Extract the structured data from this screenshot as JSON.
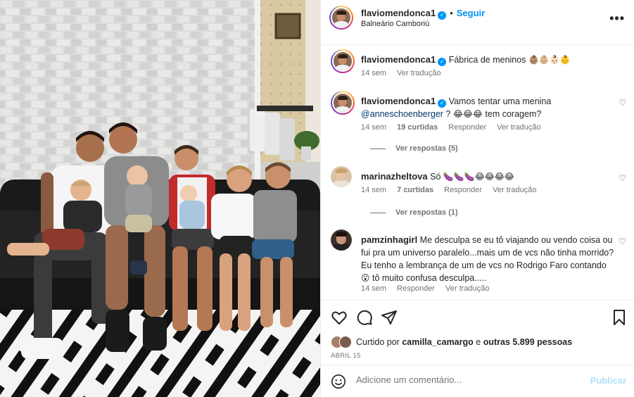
{
  "post": {
    "username": "flaviomendonca1",
    "follow_label": "Seguir",
    "location": "Balneário Camboriú",
    "more_label": "•••"
  },
  "comments": [
    {
      "username": "flaviomendonca1",
      "verified": true,
      "text": "Fábrica de meninos",
      "emojis": "👶🏽👶🏼👶🏻👶",
      "time": "14 sem",
      "translate": "Ver tradução"
    },
    {
      "username": "flaviomendonca1",
      "verified": true,
      "text_pre": "Vamos tentar uma menina",
      "mention": "@anneschoenberger",
      "text_post": "?",
      "emojis": "😂😂😂",
      "text_end": "tem coragem?",
      "time": "14 sem",
      "likes": "19 curtidas",
      "reply": "Responder",
      "translate": "Ver tradução",
      "view_replies": "Ver respostas (5)"
    },
    {
      "username": "marinazheltova",
      "text": "Só",
      "emojis": "🍆🍆🍆😂😂😂😂",
      "time": "14 sem",
      "likes": "7 curtidas",
      "reply": "Responder",
      "translate": "Ver tradução",
      "view_replies": "Ver respostas (1)"
    },
    {
      "username": "pamzinhagirl",
      "text": "Me desculpa se eu tô viajando ou vendo coisa ou fui pra um universo paralelo...mais um de vcs não tinha morrido? Eu tenho a lembrança de um de vcs no Rodrigo Faro contando",
      "emojis": "😮",
      "text_end": "tô muito confusa desculpa.....",
      "time": "14 sem",
      "reply": "Responder",
      "translate": "Ver tradução"
    }
  ],
  "likes": {
    "prefix": "Curtido por",
    "user": "camilla_camargo",
    "middle": "e",
    "others": "outras 5.899 pessoas"
  },
  "date": "ABRIL 15",
  "add_comment": {
    "placeholder": "Adicione um comentário...",
    "publish": "Publicar"
  },
  "icons": {
    "like": "heart-icon",
    "comment": "comment-icon",
    "share": "share-icon",
    "save": "bookmark-icon",
    "emoji": "emoji-icon"
  },
  "colors": {
    "accent": "#0095f6",
    "text": "#262626",
    "muted": "#737373",
    "publish_disabled": "#b2dffc"
  }
}
